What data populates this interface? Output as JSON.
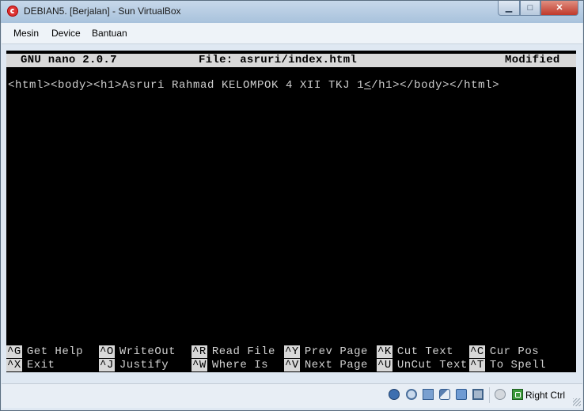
{
  "window": {
    "title": "DEBIAN5. [Berjalan] - Sun VirtualBox",
    "controls": {
      "minimize": "▁",
      "maximize": "□",
      "close": "✕"
    }
  },
  "menubar": {
    "items": [
      "Mesin",
      "Device",
      "Bantuan"
    ]
  },
  "nano": {
    "header": {
      "version": "GNU nano 2.0.7",
      "file": "File: asruri/index.html",
      "status": "Modified"
    },
    "content": {
      "before_cursor": "<html><body><h1>Asruri Rahmad KELOMPOK 4 XII TKJ 1",
      "cursor_char": "<",
      "after_cursor": "/h1></body></html>"
    },
    "shortcuts_row1": [
      {
        "key": "^G",
        "label": "Get Help"
      },
      {
        "key": "^O",
        "label": "WriteOut"
      },
      {
        "key": "^R",
        "label": "Read File"
      },
      {
        "key": "^Y",
        "label": "Prev Page"
      },
      {
        "key": "^K",
        "label": "Cut Text"
      },
      {
        "key": "^C",
        "label": "Cur Pos"
      }
    ],
    "shortcuts_row2": [
      {
        "key": "^X",
        "label": "Exit"
      },
      {
        "key": "^J",
        "label": "Justify"
      },
      {
        "key": "^W",
        "label": "Where Is"
      },
      {
        "key": "^V",
        "label": "Next Page"
      },
      {
        "key": "^U",
        "label": "UnCut Text"
      },
      {
        "key": "^T",
        "label": "To Spell"
      }
    ]
  },
  "statusbar": {
    "icons": [
      "hard-disk-icon",
      "cd-dvd-icon",
      "network-icon",
      "usb-icon",
      "shared-folders-icon",
      "virtualization-icon",
      "mouse-integration-icon",
      "keyboard-capture-icon"
    ],
    "host_key": "Right Ctrl"
  }
}
